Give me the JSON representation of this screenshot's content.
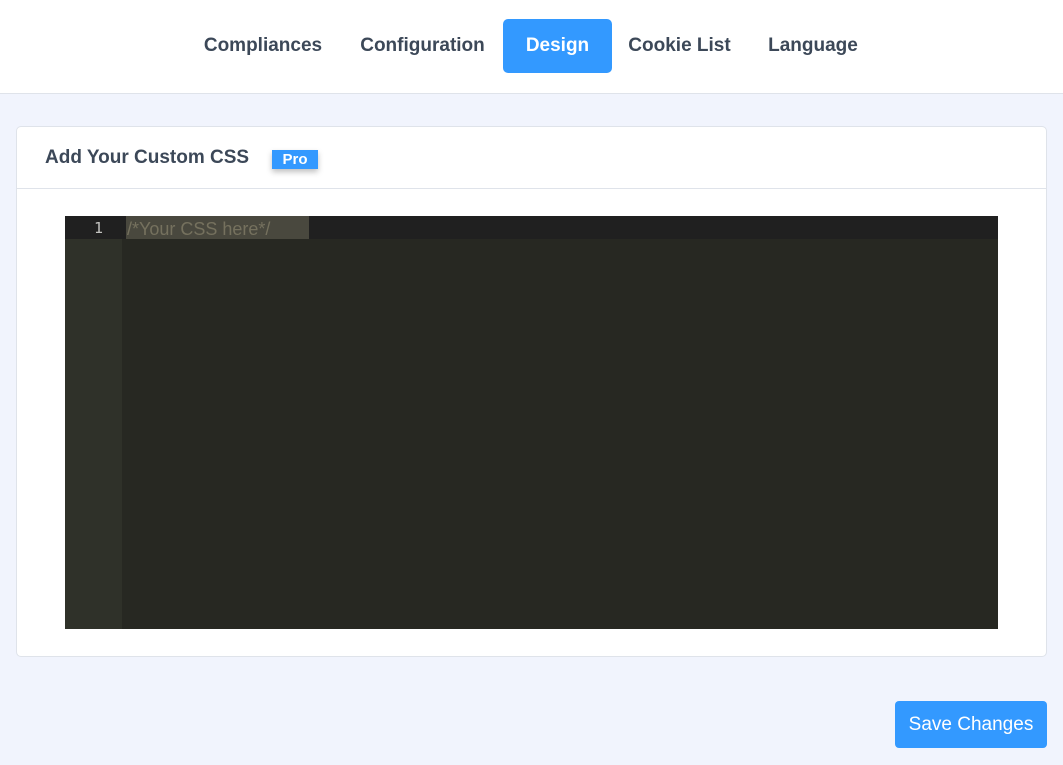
{
  "tabs": [
    {
      "label": "Compliances",
      "active": false
    },
    {
      "label": "Configuration",
      "active": false
    },
    {
      "label": "Design",
      "active": true
    },
    {
      "label": "Cookie List",
      "active": false
    },
    {
      "label": "Language",
      "active": false
    }
  ],
  "card": {
    "title": "Add Your Custom CSS",
    "badge": "Pro"
  },
  "editor": {
    "line_number": "1",
    "placeholder": "/*Your CSS here*/"
  },
  "footer": {
    "save_label": "Save Changes"
  },
  "colors": {
    "accent": "#3399ff",
    "page_background": "#f1f4fd",
    "editor_background": "#272822",
    "text": "#3c4858"
  }
}
